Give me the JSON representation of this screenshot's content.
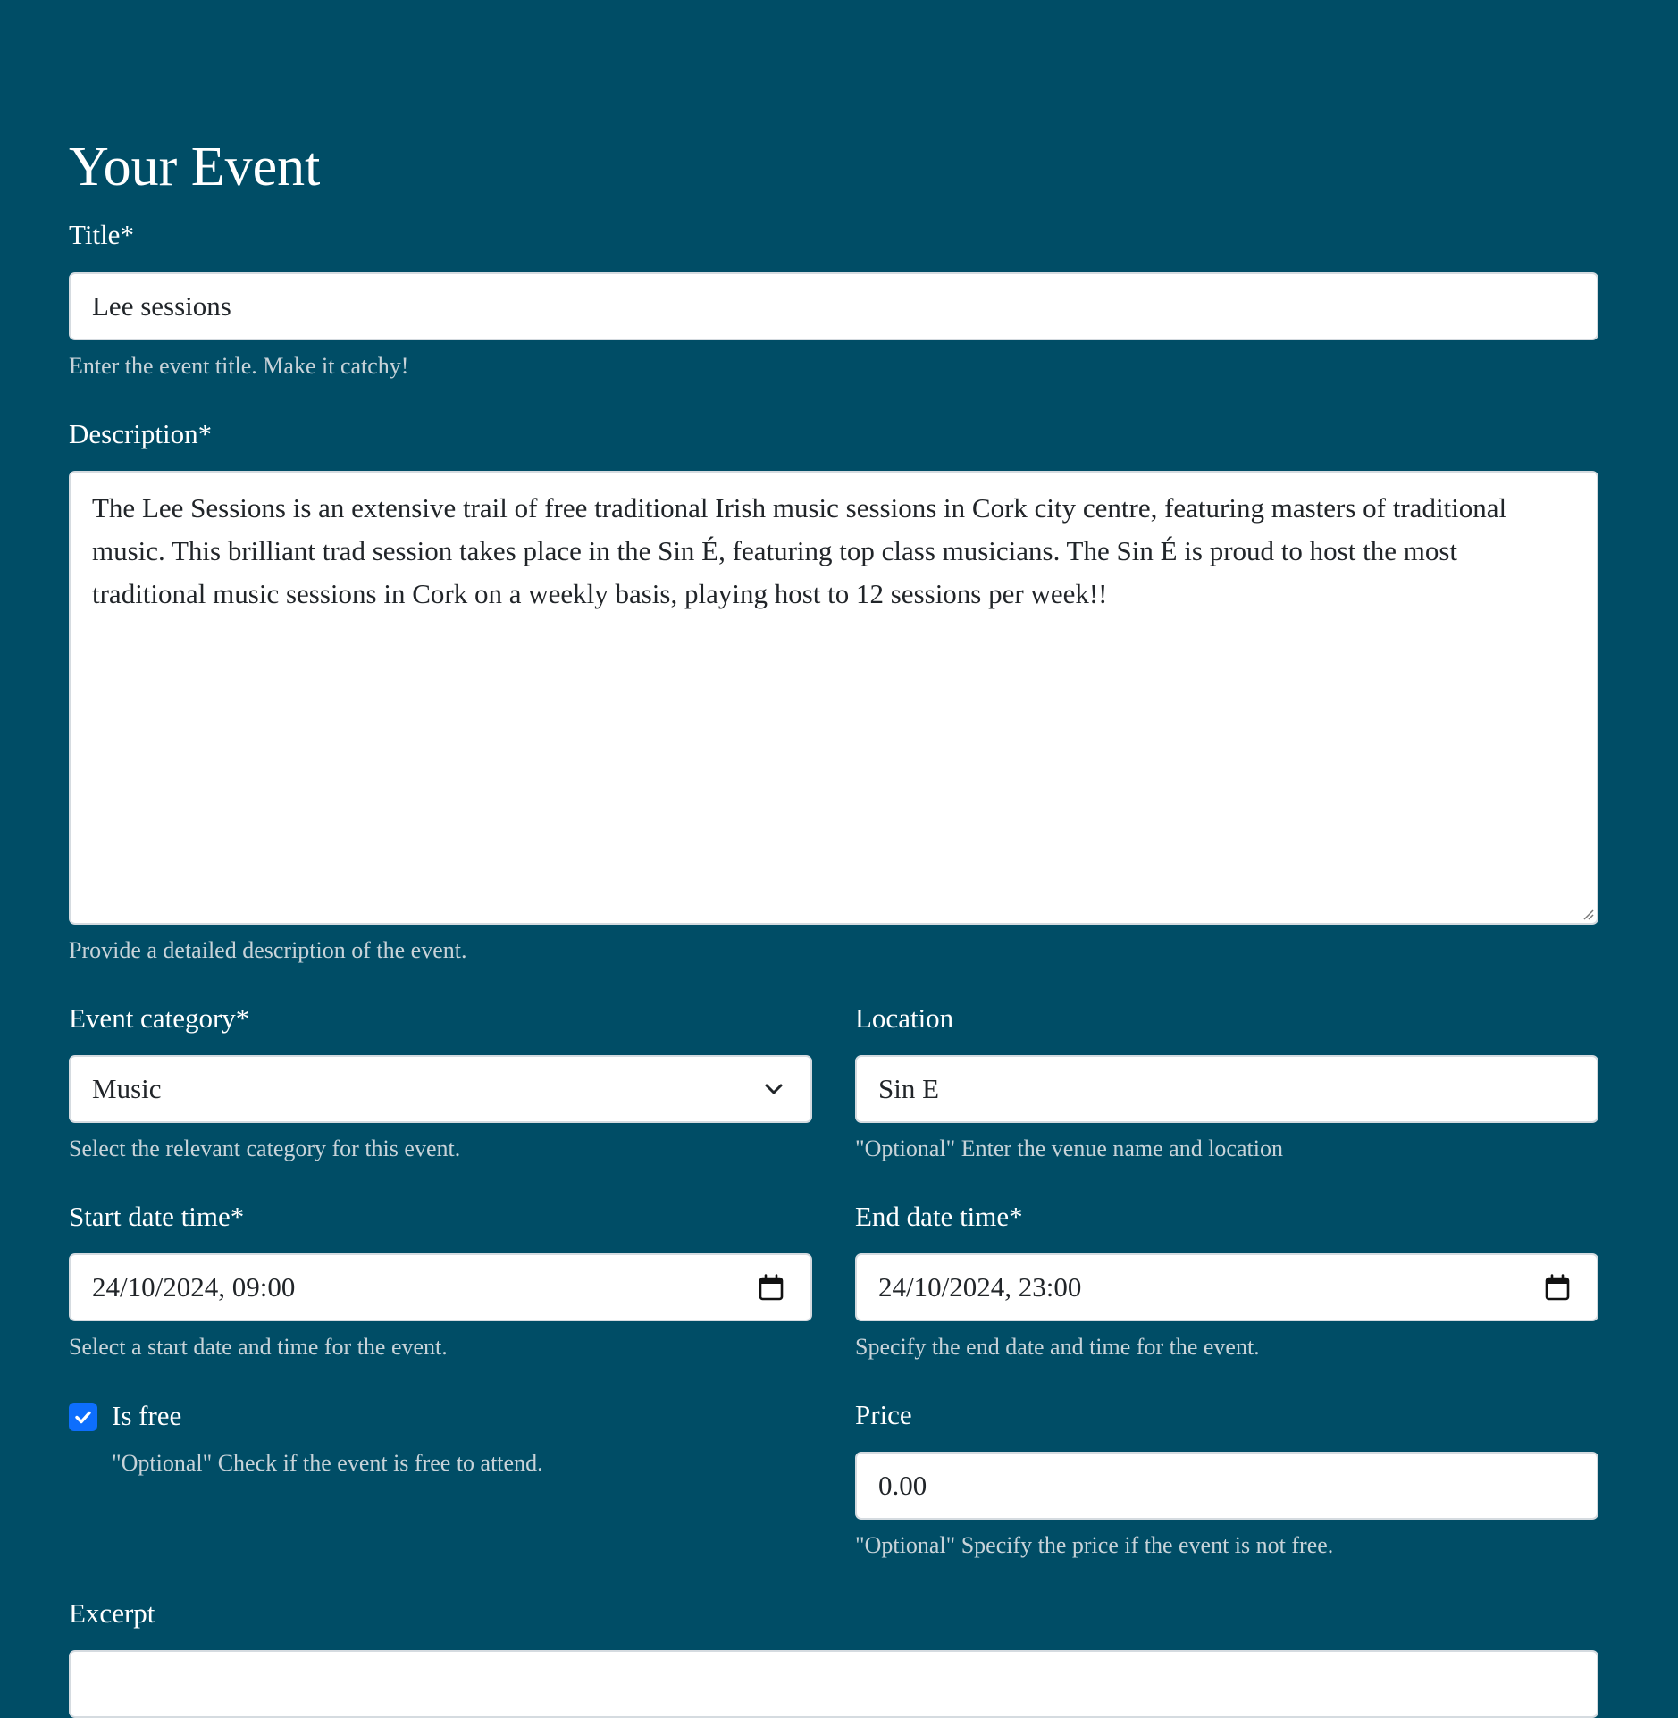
{
  "page": {
    "heading": "Your Event"
  },
  "form": {
    "title": {
      "label": "Title*",
      "value": "Lee sessions",
      "help": "Enter the event title. Make it catchy!"
    },
    "description": {
      "label": "Description*",
      "value": "The Lee Sessions is an extensive trail of free traditional Irish music sessions in Cork city centre, featuring masters of traditional music. This brilliant trad session takes place in the Sin É, featuring top class musicians. The Sin É is proud to host the most traditional music sessions in Cork on a weekly basis, playing host to 12 sessions per week!!",
      "help": "Provide a detailed description of the event."
    },
    "category": {
      "label": "Event category*",
      "selected": "Music",
      "help": "Select the relevant category for this event.",
      "icon": "chevron-down-icon"
    },
    "location": {
      "label": "Location",
      "value": "Sin E",
      "help": "\"Optional\" Enter the venue name and location"
    },
    "start": {
      "label": "Start date time*",
      "value": "24/10/2024, 09:00",
      "help": "Select a start date and time for the event.",
      "icon": "calendar-icon"
    },
    "end": {
      "label": "End date time*",
      "value": "24/10/2024, 23:00",
      "help": "Specify the end date and time for the event.",
      "icon": "calendar-icon"
    },
    "is_free": {
      "label": "Is free",
      "checked": true,
      "help": "\"Optional\" Check if the event is free to attend."
    },
    "price": {
      "label": "Price",
      "value": "0.00",
      "help": "\"Optional\" Specify the price if the event is not free."
    },
    "excerpt": {
      "label": "Excerpt"
    }
  },
  "colors": {
    "background": "#004d66",
    "input_background": "#ffffff",
    "input_border": "#d5dbe0",
    "help_text": "#c8d3d9",
    "checkbox_accent": "#0d6efd"
  }
}
